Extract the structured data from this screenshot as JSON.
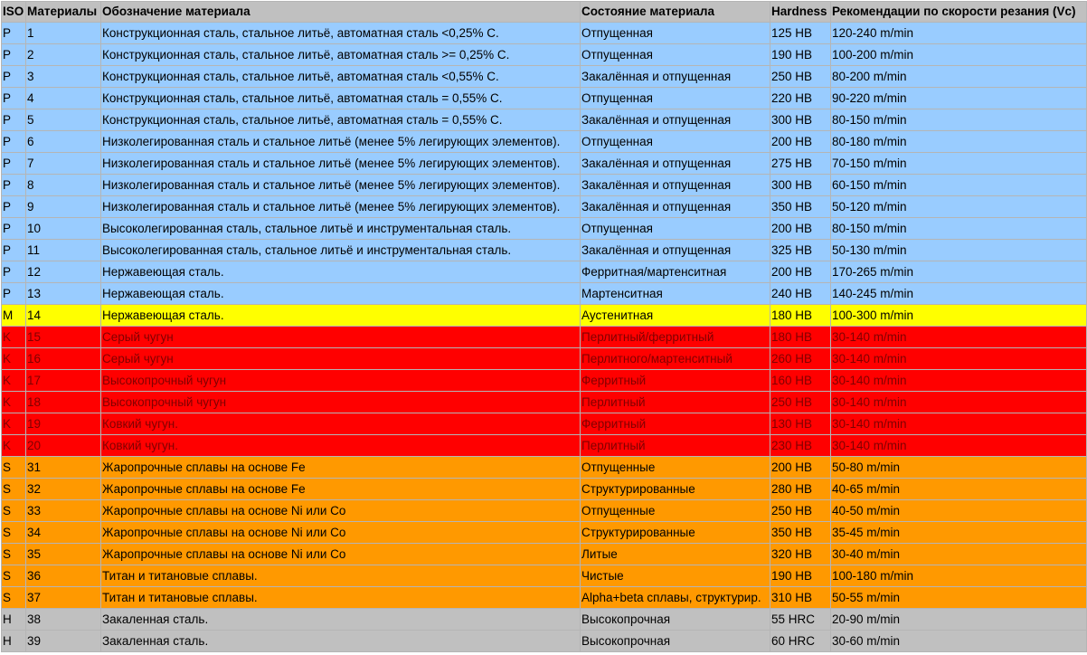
{
  "table": {
    "headers": {
      "iso": "ISO",
      "material": "Материалы",
      "designation": "Обозначение материала",
      "state": "Состояние материала",
      "hardness": "Hardness",
      "speed": "Рекомендации по скорости резания (Vc)"
    },
    "group_colors": {
      "P": "#99ccff",
      "M": "#ffff00",
      "K": "#ff0000",
      "S": "#ff9900",
      "H": "#c0c0c0"
    },
    "rows": [
      {
        "iso": "P",
        "material": "1",
        "designation": "Конструкционная сталь, стальное литьё, автоматная сталь <0,25% С.",
        "state": "Отпущенная",
        "hardness": "125 HB",
        "speed": "120-240 m/min"
      },
      {
        "iso": "P",
        "material": "2",
        "designation": "Конструкционная сталь, стальное литьё, автоматная сталь >= 0,25% С.",
        "state": "Отпущенная",
        "hardness": "190 HB",
        "speed": "100-200 m/min"
      },
      {
        "iso": "P",
        "material": "3",
        "designation": "Конструкционная сталь, стальное литьё, автоматная сталь <0,55% С.",
        "state": "Закалённая и отпущенная",
        "hardness": "250 HB",
        "speed": "80-200 m/min"
      },
      {
        "iso": "P",
        "material": "4",
        "designation": "Конструкционная сталь, стальное литьё, автоматная сталь = 0,55% С.",
        "state": "Отпущенная",
        "hardness": "220 HB",
        "speed": "90-220 m/min"
      },
      {
        "iso": "P",
        "material": "5",
        "designation": "Конструкционная сталь, стальное литьё, автоматная сталь = 0,55% С.",
        "state": "Закалённая и отпущенная",
        "hardness": "300 HB",
        "speed": "80-150 m/min"
      },
      {
        "iso": "P",
        "material": "6",
        "designation": "Низколегированная сталь и стальное литьё (менее 5% легирующих элементов).",
        "state": "Отпущенная",
        "hardness": "200 HB",
        "speed": "80-180 m/min"
      },
      {
        "iso": "P",
        "material": "7",
        "designation": "Низколегированная сталь и стальное литьё (менее 5% легирующих элементов).",
        "state": "Закалённая и отпущенная",
        "hardness": "275 HB",
        "speed": "70-150 m/min"
      },
      {
        "iso": "P",
        "material": "8",
        "designation": "Низколегированная сталь и стальное литьё (менее 5% легирующих элементов).",
        "state": "Закалённая и отпущенная",
        "hardness": "300 HB",
        "speed": "60-150 m/min"
      },
      {
        "iso": "P",
        "material": "9",
        "designation": "Низколегированная сталь и стальное литьё (менее 5% легирующих элементов).",
        "state": "Закалённая и отпущенная",
        "hardness": "350 HB",
        "speed": "50-120 m/min"
      },
      {
        "iso": "P",
        "material": "10",
        "designation": "Высоколегированная сталь, стальное литьё и инструментальная сталь.",
        "state": "Отпущенная",
        "hardness": "200 HB",
        "speed": "80-150 m/min"
      },
      {
        "iso": "P",
        "material": "11",
        "designation": "Высоколегированная сталь, стальное литьё и инструментальная сталь.",
        "state": "Закалённая и отпущенная",
        "hardness": "325 HB",
        "speed": "50-130 m/min"
      },
      {
        "iso": "P",
        "material": "12",
        "designation": "Нержавеющая сталь.",
        "state": "Ферритная/мартенситная",
        "hardness": "200 HB",
        "speed": "170-265 m/min"
      },
      {
        "iso": "P",
        "material": "13",
        "designation": "Нержавеющая сталь.",
        "state": "Мартенситная",
        "hardness": "240 HB",
        "speed": "140-245 m/min"
      },
      {
        "iso": "M",
        "material": "14",
        "designation": "Нержавеющая сталь.",
        "state": "Аустенитная",
        "hardness": "180 HB",
        "speed": "100-300 m/min"
      },
      {
        "iso": "K",
        "material": "15",
        "designation": "Серый чугун",
        "state": "Перлитный/ферритный",
        "hardness": "180 HB",
        "speed": "30-140 m/min"
      },
      {
        "iso": "K",
        "material": "16",
        "designation": "Серый чугун",
        "state": "Перлитного/мартенситный",
        "hardness": "260 HB",
        "speed": "30-140 m/min"
      },
      {
        "iso": "K",
        "material": "17",
        "designation": "Высокопрочный чугун",
        "state": "Ферритный",
        "hardness": "160 HB",
        "speed": "30-140 m/min"
      },
      {
        "iso": "K",
        "material": "18",
        "designation": "Высокопрочный чугун",
        "state": "Перлитный",
        "hardness": "250 HB",
        "speed": "30-140 m/min"
      },
      {
        "iso": "K",
        "material": "19",
        "designation": "Ковкий чугун.",
        "state": "Ферритный",
        "hardness": "130 HB",
        "speed": "30-140 m/min"
      },
      {
        "iso": "K",
        "material": "20",
        "designation": "Ковкий чугун.",
        "state": "Перлитный",
        "hardness": "230 HB",
        "speed": "30-140 m/min"
      },
      {
        "iso": "S",
        "material": "31",
        "designation": "Жаропрочные сплавы на основе Fe",
        "state": "Отпущенные",
        "hardness": "200 HB",
        "speed": "50-80 m/min"
      },
      {
        "iso": "S",
        "material": "32",
        "designation": "Жаропрочные сплавы на основе Fe",
        "state": "Структурированные",
        "hardness": "280 HB",
        "speed": "40-65 m/min"
      },
      {
        "iso": "S",
        "material": "33",
        "designation": "Жаропрочные сплавы на основе Ni или Co",
        "state": "Отпущенные",
        "hardness": "250 HB",
        "speed": "40-50 m/min"
      },
      {
        "iso": "S",
        "material": "34",
        "designation": "Жаропрочные сплавы на основе Ni или Co",
        "state": "Структурированные",
        "hardness": "350 HB",
        "speed": "35-45 m/min"
      },
      {
        "iso": "S",
        "material": "35",
        "designation": "Жаропрочные сплавы на основе Ni или Co",
        "state": "Литые",
        "hardness": "320 HB",
        "speed": "30-40 m/min"
      },
      {
        "iso": "S",
        "material": "36",
        "designation": "Титан и титановые сплавы.",
        "state": "Чистые",
        "hardness": "190 HB",
        "speed": "100-180 m/min"
      },
      {
        "iso": "S",
        "material": "37",
        "designation": "Титан и титановые сплавы.",
        "state": "Alpha+beta сплавы, структурир.",
        "hardness": "310 HB",
        "speed": "50-55 m/min"
      },
      {
        "iso": "H",
        "material": "38",
        "designation": "Закаленная сталь.",
        "state": "Высокопрочная",
        "hardness": "55 HRC",
        "speed": "20-90 m/min"
      },
      {
        "iso": "H",
        "material": "39",
        "designation": "Закаленная сталь.",
        "state": "Высокопрочная",
        "hardness": "60 HRC",
        "speed": "30-60 m/min"
      }
    ]
  }
}
